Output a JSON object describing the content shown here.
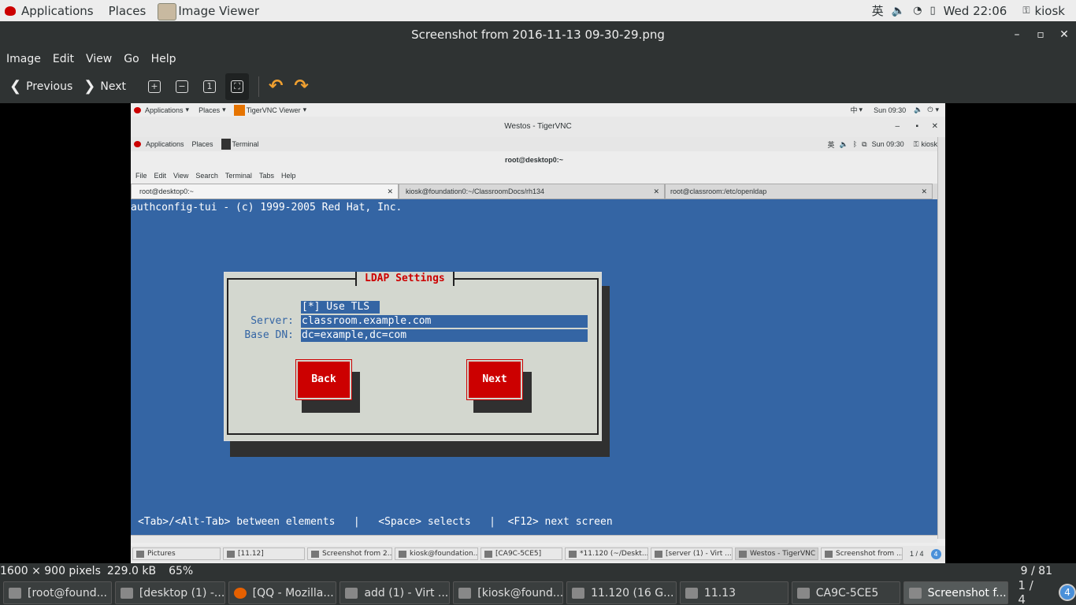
{
  "top_panel": {
    "applications": "Applications",
    "places": "Places",
    "app_name": "Image Viewer",
    "lang": "英",
    "clock": "Wed 22:06",
    "user": "kiosk"
  },
  "window": {
    "title": "Screenshot from 2016-11-13 09-30-29.png"
  },
  "menu": [
    "Image",
    "Edit",
    "View",
    "Go",
    "Help"
  ],
  "toolbar": {
    "previous": "Previous",
    "next": "Next"
  },
  "inner": {
    "top_panel": {
      "applications": "Applications",
      "places": "Places",
      "app": "TigerVNC Viewer",
      "lang": "中",
      "clock": "Sun 09:30"
    },
    "vnc_title": "Westos - TigerVNC",
    "remote_panel": {
      "applications": "Applications",
      "places": "Places",
      "app": "Terminal",
      "lang": "英",
      "clock": "Sun 09:30",
      "user": "kiosk"
    },
    "terminal_title": "root@desktop0:~",
    "terminal_menu": [
      "File",
      "Edit",
      "View",
      "Search",
      "Terminal",
      "Tabs",
      "Help"
    ],
    "tabs": [
      "root@desktop0:~",
      "kiosk@foundation0:~/ClassroomDocs/rh134",
      "root@classroom:/etc/openldap"
    ],
    "terminal": {
      "header": "authconfig-tui - (c) 1999-2005 Red Hat, Inc.",
      "dialog_title": "LDAP Settings",
      "use_tls": "[*] Use TLS",
      "server_label": "Server:",
      "server_value": "classroom.example.com",
      "basedn_label": "Base DN:",
      "basedn_value": "dc=example,dc=com",
      "back": "Back",
      "next": "Next",
      "help": "<Tab>/<Alt-Tab> between elements   |   <Space> selects   |  <F12> next screen"
    },
    "taskbar": [
      "Pictures",
      "[11.12]",
      "Screenshot from 2...",
      "kiosk@foundation...",
      "[CA9C-5CE5]",
      "*11.120 (~/Deskt...",
      "[server (1) - Virt ...",
      "Westos - TigerVNC",
      "Screenshot from ..."
    ],
    "workspace": "1 / 4",
    "workspace_badge": "4"
  },
  "statusbar": {
    "dimensions": "1600 × 900 pixels",
    "size": "229.0 kB",
    "zoom": "65%",
    "position": "9 / 81"
  },
  "taskbar": [
    "[root@found...",
    "[desktop (1) -...",
    "[QQ - Mozilla...",
    "add (1) - Virt ...",
    "[kiosk@found...",
    "11.120 (16 G...",
    "11.13",
    "CA9C-5CE5",
    "Screenshot f..."
  ],
  "workspace": "1 / 4",
  "workspace_badge": "4",
  "colors": {
    "accent_red": "#cc0000",
    "terminal_blue": "#3465a4",
    "dialog_grey": "#d3d7cf"
  }
}
